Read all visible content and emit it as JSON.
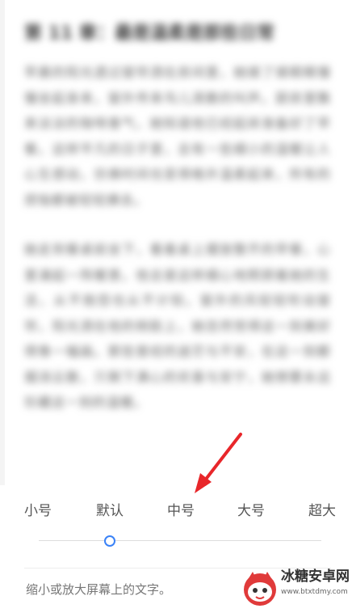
{
  "preview": {
    "title": "第 11 章：最是温柔是那些日常",
    "paragraphs": [
      "早晨的阳光透过窗帘洒在房间里，她揉了揉眼睛慢慢坐起身来，窗外传来鸟儿清脆的叫声。厨房里飘来淡淡的咖啡香气，她知道他已经起床准备好了早餐。这样平凡的日子里，总有一些细小的温暖让人心生感动，仿佛时间也变得格外温柔起来，所有的烦恼都被轻轻拂去。",
      "她走到餐桌前坐下，看着桌上摆放整齐的早餐，心里涌起一阵暖意。他总是这样细心地照顾着她的生活，从不抱怨也从不计较。窗外的风轻轻吹动窗帘，阳光洒在他的侧脸上，她忽然觉得这一刻美好得像一幅画。那些曾经的迷茫与不安，在这一刻都烟消云散，只剩下满心的欢喜与安宁，她想要永远珍藏这一刻的温暖。"
    ]
  },
  "font_size": {
    "options": [
      "小号",
      "默认",
      "中号",
      "大号",
      "超大"
    ],
    "selected": "默认",
    "selected_index": 1
  },
  "description": "缩小或放大屏幕上的文字。",
  "watermark": {
    "title": "冰糖安卓网",
    "url": "www.btxtdmy.com"
  },
  "colors": {
    "accent": "#3a82f7",
    "annotation_arrow": "#e8262a"
  }
}
